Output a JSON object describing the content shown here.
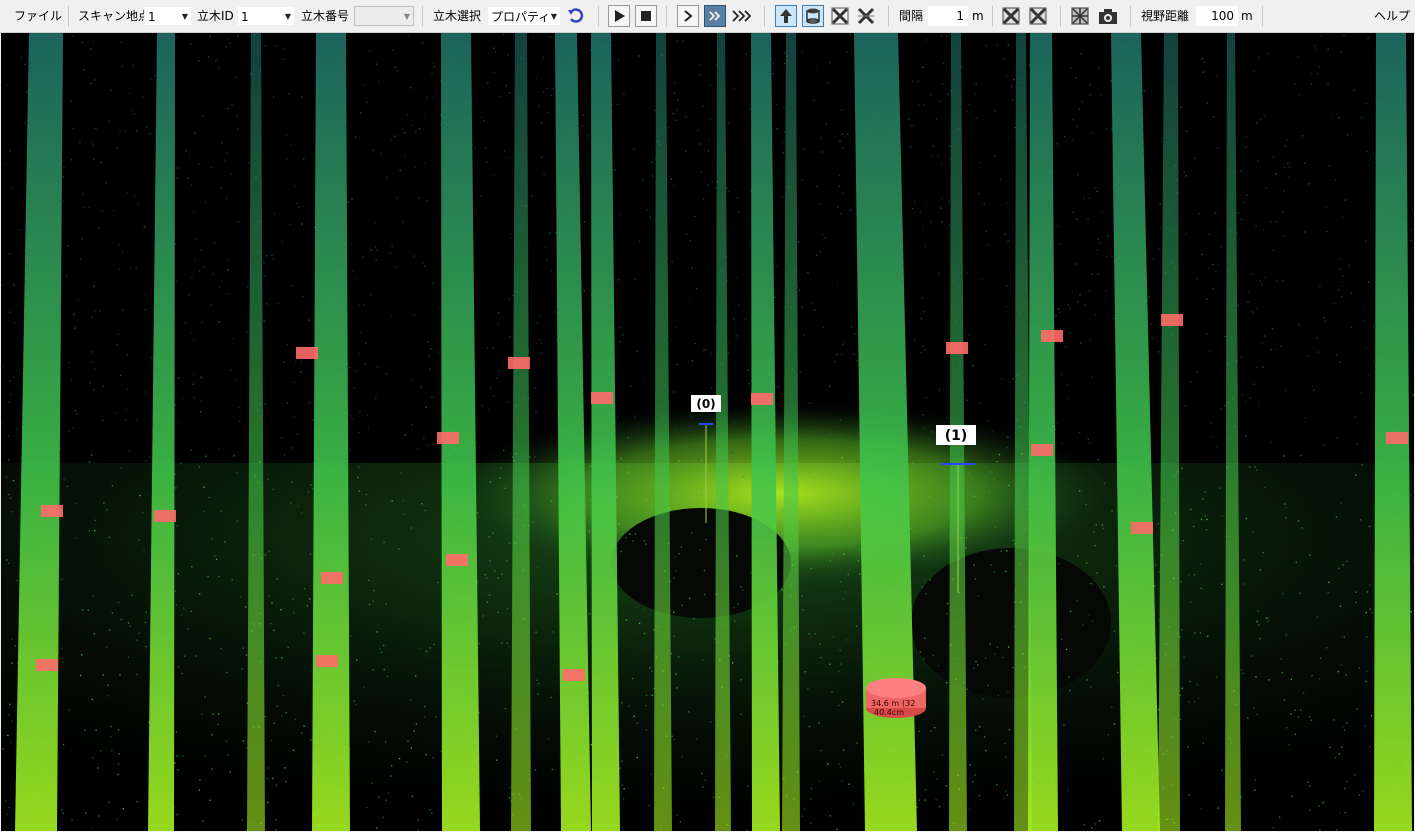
{
  "toolbar": {
    "file_menu": "ファイル",
    "scan_point_label": "スキャン地点",
    "scan_point_value": "1",
    "tree_id_label": "立木ID",
    "tree_id_value": "1",
    "tree_number_label": "立木番号",
    "tree_number_value": "",
    "tree_select_label": "立木選択",
    "tree_select_value": "プロパティ",
    "interval_label": "間隔",
    "interval_value": "1",
    "interval_unit": "m",
    "view_distance_label": "視野距離",
    "view_distance_value": "100",
    "view_distance_unit": "m",
    "help_menu": "ヘルプ",
    "icons": [
      "undo-icon",
      "play-icon",
      "stop-icon",
      "step-forward-icon",
      "fast-forward-icon",
      "skip-forward-icon",
      "up-arrow-icon",
      "cylinder-icon",
      "cross-icon",
      "double-cross-icon",
      "grid-cross-icon",
      "grid-cross-icon",
      "hatched-box-icon",
      "camera-icon"
    ]
  },
  "viewport": {
    "marker_0": "(0)",
    "marker_1": "(1)",
    "tree_label_a": "34.6 m",
    "tree_label_b": "(32",
    "tree_label_c": "40.4cm",
    "colors": {
      "background": "#000000",
      "bright": "#c8ff1e",
      "mid": "#3fd44a",
      "dark": "#1f7a6e",
      "tag": "#ff6a6a"
    }
  }
}
